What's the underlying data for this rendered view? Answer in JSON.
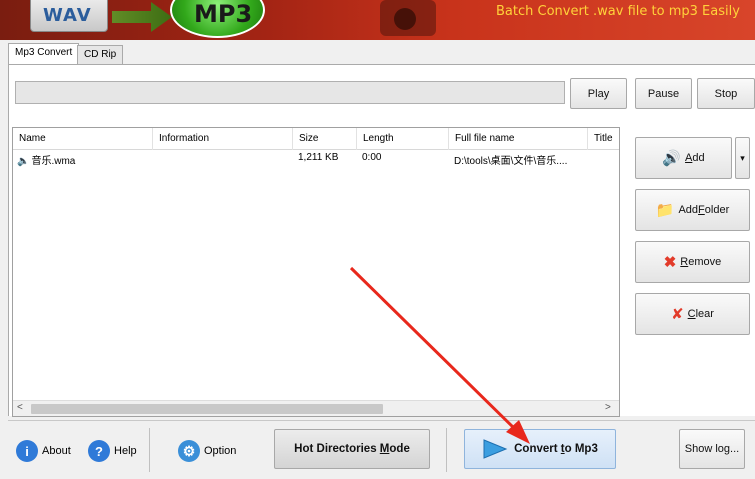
{
  "banner": {
    "wav_logo_text": "WAV",
    "mp3_logo_text": "MP3",
    "tagline": "Batch Convert .wav file to mp3 Easily"
  },
  "tabs": [
    {
      "label": "Mp3 Convert",
      "active": true
    },
    {
      "label": "CD Rip",
      "active": false
    }
  ],
  "player": {
    "path_value": "",
    "play_label": "Play",
    "pause_label": "Pause",
    "stop_label": "Stop"
  },
  "file_list": {
    "columns": [
      "Name",
      "Information",
      "Size",
      "Length",
      "Full file name",
      "Title"
    ],
    "rows": [
      {
        "name": "音乐.wma",
        "information": "",
        "size": "1,211 KB",
        "length": "0:00",
        "full_file_name": "D:\\tools\\桌面\\文件\\音乐....",
        "title": ""
      }
    ]
  },
  "side_buttons": {
    "add": {
      "text": "Add",
      "ul": "A",
      "rest": "dd"
    },
    "add_folder": {
      "pre": "Add ",
      "ul": "F",
      "rest": "older"
    },
    "remove": {
      "ul": "R",
      "rest": "emove"
    },
    "clear": {
      "ul": "C",
      "rest": "lear"
    },
    "dropdown_glyph": "▾"
  },
  "bottom": {
    "about": {
      "ul": "A",
      "rest": "bout"
    },
    "help": {
      "ul": "H",
      "rest": "elp"
    },
    "option_label": "Option",
    "hot_dirs": {
      "pre": "Hot Directories ",
      "ul": "M",
      "rest": "ode"
    },
    "convert": {
      "pre": "Convert ",
      "ul": "t",
      "rest": "o Mp3"
    },
    "show_log_label": "Show log..."
  },
  "colors": {
    "banner_red": "#c8331b",
    "tagline_yellow": "#ffd23a",
    "annotation_arrow": "#e8281c",
    "convert_button_bg": "#dbe9f7"
  }
}
